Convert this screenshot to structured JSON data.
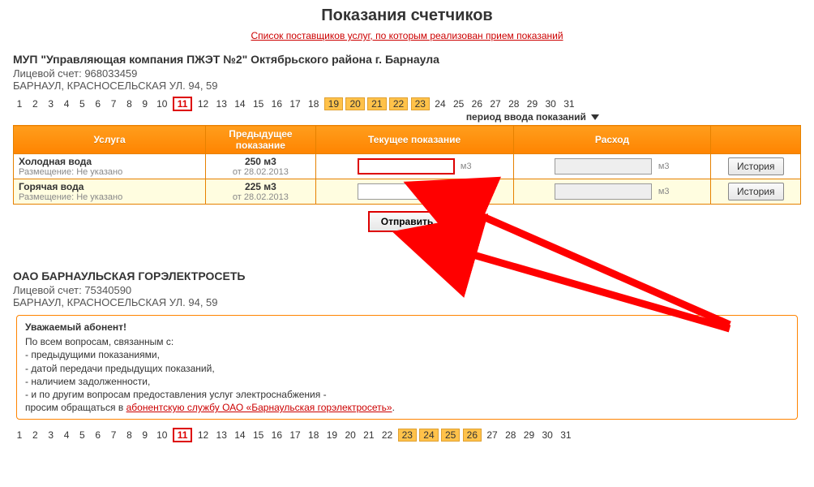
{
  "title": "Показания счетчиков",
  "providers_link_text": "Список поставщиков услуг, по которым реализован прием показаний",
  "period_label": "период ввода показаний",
  "table_headers": {
    "service": "Услуга",
    "prev": "Предыдущее показание",
    "current": "Текущее показание",
    "cons": "Расход"
  },
  "history_label": "История",
  "submit_label": "Отправить",
  "unit": "м3",
  "placement_prefix": "Размещение: ",
  "placement_value": "Не указано",
  "date_prefix": "от ",
  "providers": [
    {
      "company": "МУП \"Управляющая компания ПЖЭТ №2\" Октябрьского района г. Барнаула",
      "account_label": "Лицевой счет:",
      "account": "968033459",
      "address": "БАРНАУЛ, КРАСНОСЕЛЬСКАЯ УЛ. 94, 59",
      "days": {
        "current": 11,
        "range_start": 19,
        "range_end": 23,
        "total": 31
      },
      "rows": [
        {
          "name": "Холодная вода",
          "prev_value": "250 м3",
          "prev_date": "28.02.2013",
          "highlight": true
        },
        {
          "name": "Горячая вода",
          "prev_value": "225 м3",
          "prev_date": "28.02.2013",
          "highlight": false
        }
      ]
    },
    {
      "company": "ОАО БАРНАУЛЬСКАЯ ГОРЭЛЕКТРОСЕТЬ",
      "account_label": "Лицевой счет:",
      "account": "75340590",
      "address": "БАРНАУЛ, КРАСНОСЕЛЬСКАЯ УЛ. 94, 59",
      "days": {
        "current": 11,
        "range_start": 23,
        "range_end": 26,
        "total": 31
      },
      "notice": {
        "title": "Уважаемый абонент!",
        "lines": [
          "По всем вопросам, связанным с:",
          "- предыдущими показаниями,",
          "- датой передачи предыдущих показаний,",
          "- наличием задолженности,",
          "- и по другим вопросам предоставления услуг электроснабжения -"
        ],
        "contact_prefix": "просим обращаться в ",
        "contact_link": "абонентскую службу ОАО «Барнаульская горэлектросеть»",
        "contact_suffix": "."
      }
    }
  ]
}
